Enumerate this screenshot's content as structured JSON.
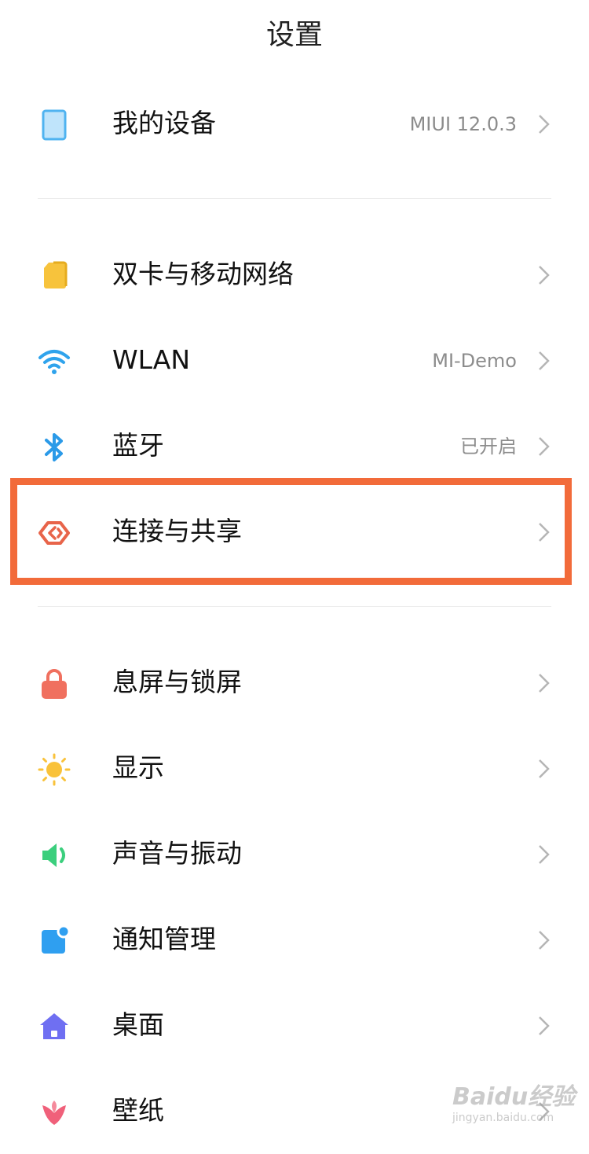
{
  "header": {
    "title": "设置"
  },
  "rows": [
    {
      "label": "我的设备",
      "value": "MIUI 12.0.3",
      "icon": "device-icon",
      "color": "#4fb3f0"
    },
    {
      "label": "双卡与移动网络",
      "value": "",
      "icon": "sim-card-icon",
      "color": "#f7c33c"
    },
    {
      "label": "WLAN",
      "value": "MI-Demo",
      "icon": "wifi-icon",
      "color": "#2fa3ec"
    },
    {
      "label": "蓝牙",
      "value": "已开启",
      "icon": "bluetooth-icon",
      "color": "#2b9ae8"
    },
    {
      "label": "连接与共享",
      "value": "",
      "icon": "connection-share-icon",
      "color": "#e8644a"
    },
    {
      "label": "息屏与锁屏",
      "value": "",
      "icon": "lock-icon",
      "color": "#f0705f"
    },
    {
      "label": "显示",
      "value": "",
      "icon": "sun-icon",
      "color": "#f9c23a"
    },
    {
      "label": "声音与振动",
      "value": "",
      "icon": "speaker-icon",
      "color": "#3bcf7d"
    },
    {
      "label": "通知管理",
      "value": "",
      "icon": "notification-icon",
      "color": "#2f9ff0"
    },
    {
      "label": "桌面",
      "value": "",
      "icon": "home-icon",
      "color": "#6f6ff2"
    },
    {
      "label": "壁纸",
      "value": "",
      "icon": "flower-icon",
      "color": "#f0607a"
    }
  ],
  "highlight_color": "#f26b3a",
  "watermark": {
    "brand": "Baidu经验",
    "url": "jingyan.baidu.com"
  }
}
